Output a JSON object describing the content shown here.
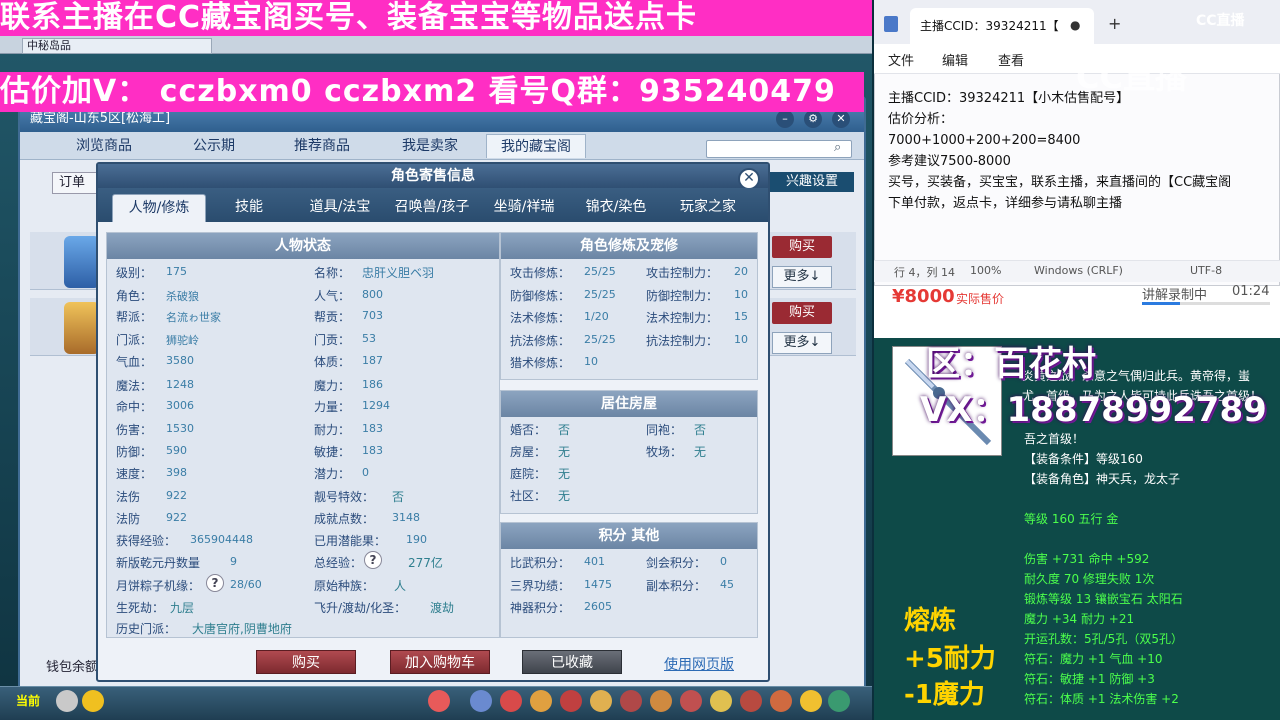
{
  "banners": {
    "top": "联系主播在CC藏宝阁买号、装备宝宝等物品送点卡",
    "second": "估价加V： cczbxm0   cczbxm2   看号Q群：935240479"
  },
  "game": {
    "tab_title": "中秘岛品",
    "window_title": "藏宝阁-山东5区[松海工]",
    "nav": [
      "浏览商品",
      "公示期",
      "推荐商品",
      "我是卖家",
      "我的藏宝阁"
    ],
    "order_label": "订单",
    "interest_btn": "兴趣设置",
    "buy_label": "购买",
    "more_label": "更多↓",
    "wallet": "钱包余额",
    "taskbar_label": "当前"
  },
  "dialog": {
    "title": "角色寄售信息",
    "tabs": [
      "人物/修炼",
      "技能",
      "道具/法宝",
      "召唤兽/孩子",
      "坐骑/祥瑞",
      "锦衣/染色",
      "玩家之家"
    ],
    "status": {
      "title": "人物状态",
      "left": [
        {
          "label": "级别：",
          "value": "175"
        },
        {
          "label": "角色：",
          "value": "杀破狼"
        },
        {
          "label": "帮派：",
          "value": "名流ゎ世家"
        },
        {
          "label": "门派：",
          "value": "狮驼岭"
        },
        {
          "label": "气血：",
          "value": "3580"
        },
        {
          "label": "魔法：",
          "value": "1248"
        },
        {
          "label": "命中：",
          "value": "3006"
        },
        {
          "label": "伤害：",
          "value": "1530"
        },
        {
          "label": "防御：",
          "value": "590"
        },
        {
          "label": "速度：",
          "value": "398"
        },
        {
          "label": "法伤",
          "value": "922"
        },
        {
          "label": "法防",
          "value": "922"
        }
      ],
      "right": [
        {
          "label": "名称：",
          "value": "忠肝义胆ベ羽"
        },
        {
          "label": "人气：",
          "value": "800"
        },
        {
          "label": "帮贡：",
          "value": "703"
        },
        {
          "label": "门贡：",
          "value": "53"
        },
        {
          "label": "体质：",
          "value": "187"
        },
        {
          "label": "魔力：",
          "value": "186"
        },
        {
          "label": "力量：",
          "value": "1294"
        },
        {
          "label": "耐力：",
          "value": "183"
        },
        {
          "label": "敏捷：",
          "value": "183"
        },
        {
          "label": "潜力：",
          "value": "0"
        },
        {
          "label": "靓号特效：",
          "value": "否"
        },
        {
          "label": "成就点数：",
          "value": "3148"
        }
      ],
      "exp_label": "获得经验：",
      "exp_value": "365904448",
      "potential_used_label": "已用潜能果：",
      "potential_used_value": "190",
      "qiankun_label": "新版乾元丹数量",
      "qiankun_value": "9",
      "total_exp_label": "总经验：",
      "total_exp_value": "277亿",
      "zongzi_label": "月饼粽子机缘：",
      "zongzi_value": "28/60",
      "race_label": "原始种族：",
      "race_value": "人",
      "life_label": "生死劫：",
      "life_value": "九层",
      "fly_label": "飞升/渡劫/化圣：",
      "fly_value": "渡劫",
      "history_label": "历史门派：",
      "history_value": "大唐官府,阴曹地府",
      "q_mark": "?"
    },
    "cultivation": {
      "title": "角色修炼及宠修",
      "left": [
        {
          "label": "攻击修炼：",
          "value": "25/25"
        },
        {
          "label": "防御修炼：",
          "value": "25/25"
        },
        {
          "label": "法术修炼：",
          "value": "1/20"
        },
        {
          "label": "抗法修炼：",
          "value": "25/25"
        },
        {
          "label": "猎术修炼：",
          "value": "10"
        }
      ],
      "right": [
        {
          "label": "攻击控制力：",
          "value": "20"
        },
        {
          "label": "防御控制力：",
          "value": "10"
        },
        {
          "label": "法术控制力：",
          "value": "15"
        },
        {
          "label": "抗法控制力：",
          "value": "10"
        }
      ]
    },
    "house": {
      "title": "居住房屋",
      "left": [
        {
          "label": "婚否：",
          "value": "否"
        },
        {
          "label": "房屋：",
          "value": "无"
        },
        {
          "label": "庭院：",
          "value": "无"
        },
        {
          "label": "社区：",
          "value": "无"
        }
      ],
      "right": [
        {
          "label": "同袍：",
          "value": "否"
        },
        {
          "label": "牧场：",
          "value": "无"
        }
      ]
    },
    "points": {
      "title": "积分 其他",
      "left": [
        {
          "label": "比武积分：",
          "value": "401"
        },
        {
          "label": "三界功绩：",
          "value": "1475"
        },
        {
          "label": "神器积分：",
          "value": "2605"
        }
      ],
      "right": [
        {
          "label": "剑会积分：",
          "value": "0"
        },
        {
          "label": "副本积分：",
          "value": "45"
        }
      ]
    },
    "buttons": {
      "buy": "购买",
      "cart": "加入购物车",
      "fav": "已收藏",
      "web": "使用网页版"
    }
  },
  "notepad": {
    "tab_title": "主播CCID：39324211【",
    "menu": [
      "文件",
      "编辑",
      "查看"
    ],
    "lines": [
      "主播CCID：39324211【小木估售配号】",
      "估价分析：",
      "7000+1000+200+200=8400",
      "参考建议7500-8000",
      "买号，买装备，买宝宝，联系主播，来直播间的【CC藏宝阁",
      "下单付款，返点卡，详细参与请私聊主播"
    ],
    "status": {
      "pos": "行 4，列 14",
      "zoom": "100%",
      "eol": "Windows (CRLF)",
      "enc": "UTF-8"
    }
  },
  "cc": {
    "watermark": "CC直播",
    "big": "CC直播"
  },
  "price": {
    "value": "¥8000",
    "label": "实际售价",
    "live": "讲解录制中",
    "time": "01:24",
    "progress": 0.3
  },
  "item": {
    "quote": "炎黄之战，杀意之气偶归此兵。黄帝得，蚩尤，首级，乃为之人皆可持此兵诛吾之首级！",
    "lines": [
      "吾之首级！",
      "【装备条件】等级160",
      "【装备角色】神天兵，龙太子",
      "",
      "等级 160 五行 金",
      "",
      "伤害 +731 命中 +592",
      "耐久度 70 修理失败 1次",
      "锻炼等级 13 镶嵌宝石 太阳石",
      "魔力 +34 耐力 +21",
      "开运孔数：5孔/5孔（双5孔）",
      "符石：魔力 +1 气血 +10",
      "符石：敏捷 +1 防御 +3",
      "符石：体质 +1 法术伤害 +2"
    ],
    "zone": "区：百花村",
    "vx": "VX：18878992789",
    "refine_title": "熔炼",
    "refine_1": "+5耐力",
    "refine_2": "-1魔力"
  }
}
